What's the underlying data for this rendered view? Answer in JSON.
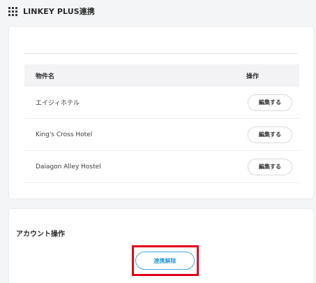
{
  "header": {
    "icon": "grid-icon",
    "title": "LINKEY PLUS連携"
  },
  "properties": {
    "columns": {
      "name": "物件名",
      "action": "操作"
    },
    "rows": [
      {
        "name": "エイジィホテル",
        "action_label": "編集する"
      },
      {
        "name": "King's Cross Hotel",
        "action_label": "編集する"
      },
      {
        "name": "Daiagon Alley Hostel",
        "action_label": "編集する"
      }
    ]
  },
  "account": {
    "title": "アカウント操作",
    "unlink_label": "連携解除",
    "accent_color": "#2e9bd6",
    "highlight_color": "#e3001b"
  }
}
